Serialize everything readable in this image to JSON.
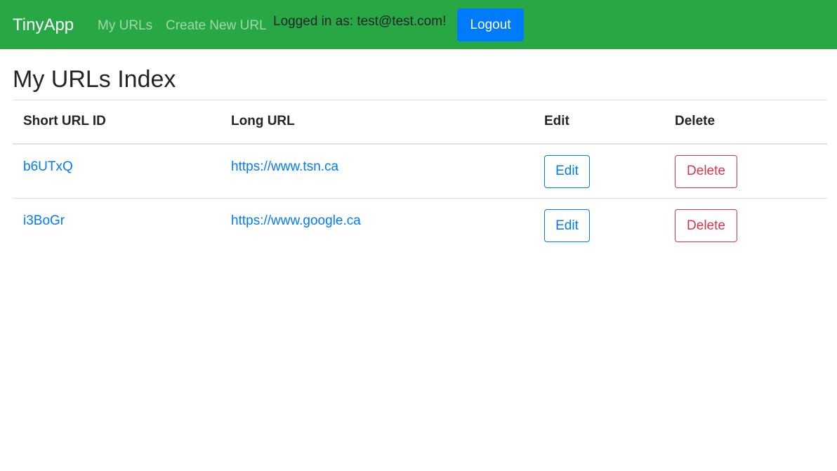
{
  "navbar": {
    "brand": "TinyApp",
    "links": [
      {
        "label": "My URLs"
      },
      {
        "label": "Create New URL"
      }
    ],
    "logged_in_text": "Logged in as: test@test.com!",
    "logout_label": "Logout"
  },
  "main": {
    "title": "My URLs Index",
    "table": {
      "headers": [
        "Short URL ID",
        "Long URL",
        "Edit",
        "Delete"
      ],
      "rows": [
        {
          "short_id": "b6UTxQ",
          "long_url": "https://www.tsn.ca",
          "edit_label": "Edit",
          "delete_label": "Delete"
        },
        {
          "short_id": "i3BoGr",
          "long_url": "https://www.google.ca",
          "edit_label": "Edit",
          "delete_label": "Delete"
        }
      ]
    }
  },
  "colors": {
    "navbar_bg": "#28a745",
    "primary": "#007bff",
    "danger": "#dc3545"
  }
}
